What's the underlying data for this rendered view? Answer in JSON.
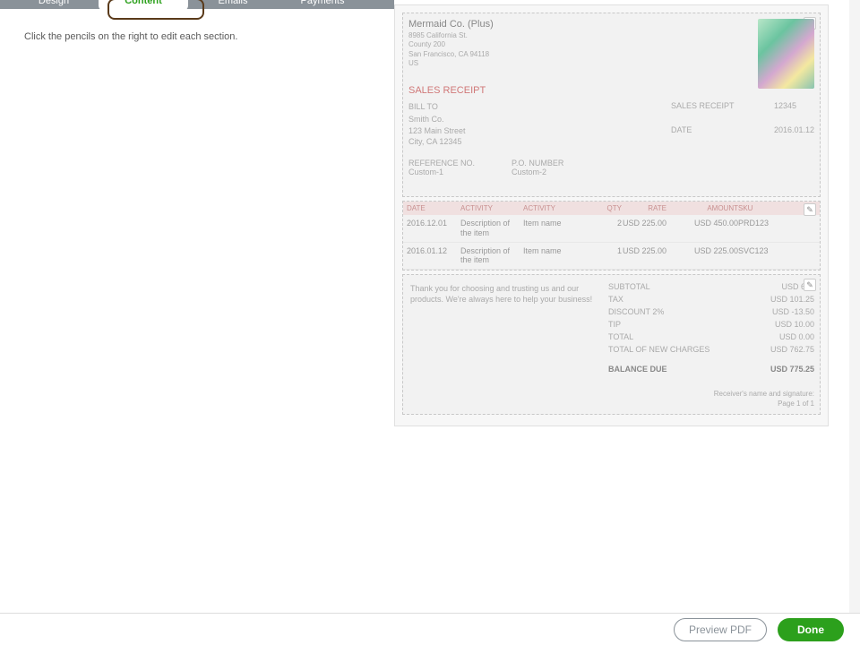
{
  "tabs": {
    "design": "Design",
    "content": "Content",
    "emails": "Emails",
    "payments": "Payments"
  },
  "hint": "Click the pencils on the right to edit each section.",
  "company": {
    "name": "Mermaid Co. (Plus)",
    "addr1": "8985 California St.",
    "addr2": "County 200",
    "addr3": "San Francisco, CA 94118",
    "addr4": "US"
  },
  "doc_title": "SALES RECEIPT",
  "bill_to": {
    "label": "BILL TO",
    "name": "Smith Co.",
    "street": "123 Main Street",
    "city": "City, CA 12345"
  },
  "meta": {
    "sales_receipt_label": "SALES RECEIPT",
    "sales_receipt_val": "12345",
    "date_label": "DATE",
    "date_val": "2016.01.12"
  },
  "refs": {
    "ref_no_label": "REFERENCE NO.",
    "ref_no_val": "Custom-1",
    "po_label": "P.O. NUMBER",
    "po_val": "Custom-2"
  },
  "table": {
    "headers": {
      "date": "DATE",
      "activity": "ACTIVITY",
      "activity2": "ACTIVITY",
      "qty": "QTY",
      "rate": "RATE",
      "amount": "AMOUNT",
      "sku": "SKU"
    },
    "rows": [
      {
        "date": "2016.12.01",
        "desc": "Description of the item",
        "name": "Item name",
        "qty": "2",
        "rate": "USD 225.00",
        "amount": "USD 450.00",
        "sku": "PRD123"
      },
      {
        "date": "2016.01.12",
        "desc": "Description of the item",
        "name": "Item name",
        "qty": "1",
        "rate": "USD 225.00",
        "amount": "USD 225.00",
        "sku": "SVC123"
      }
    ]
  },
  "message": "Thank you for choosing and trusting us and our products. We're always here to help your business!",
  "totals": {
    "subtotal_label": "SUBTOTAL",
    "subtotal_val": "USD 675",
    "tax_label": "TAX",
    "tax_val": "USD 101.25",
    "discount_label": "DISCOUNT 2%",
    "discount_val": "USD -13.50",
    "tip_label": "TIP",
    "tip_val": "USD 10.00",
    "total_label": "TOTAL",
    "total_val": "USD 0.00",
    "new_charges_label": "TOTAL OF NEW CHARGES",
    "new_charges_val": "USD 762.75",
    "balance_label": "BALANCE DUE",
    "balance_val": "USD 775.25"
  },
  "signature": {
    "line1": "Receiver's name and signature:",
    "line2": "Page 1 of 1"
  },
  "footer": {
    "preview": "Preview PDF",
    "done": "Done"
  }
}
